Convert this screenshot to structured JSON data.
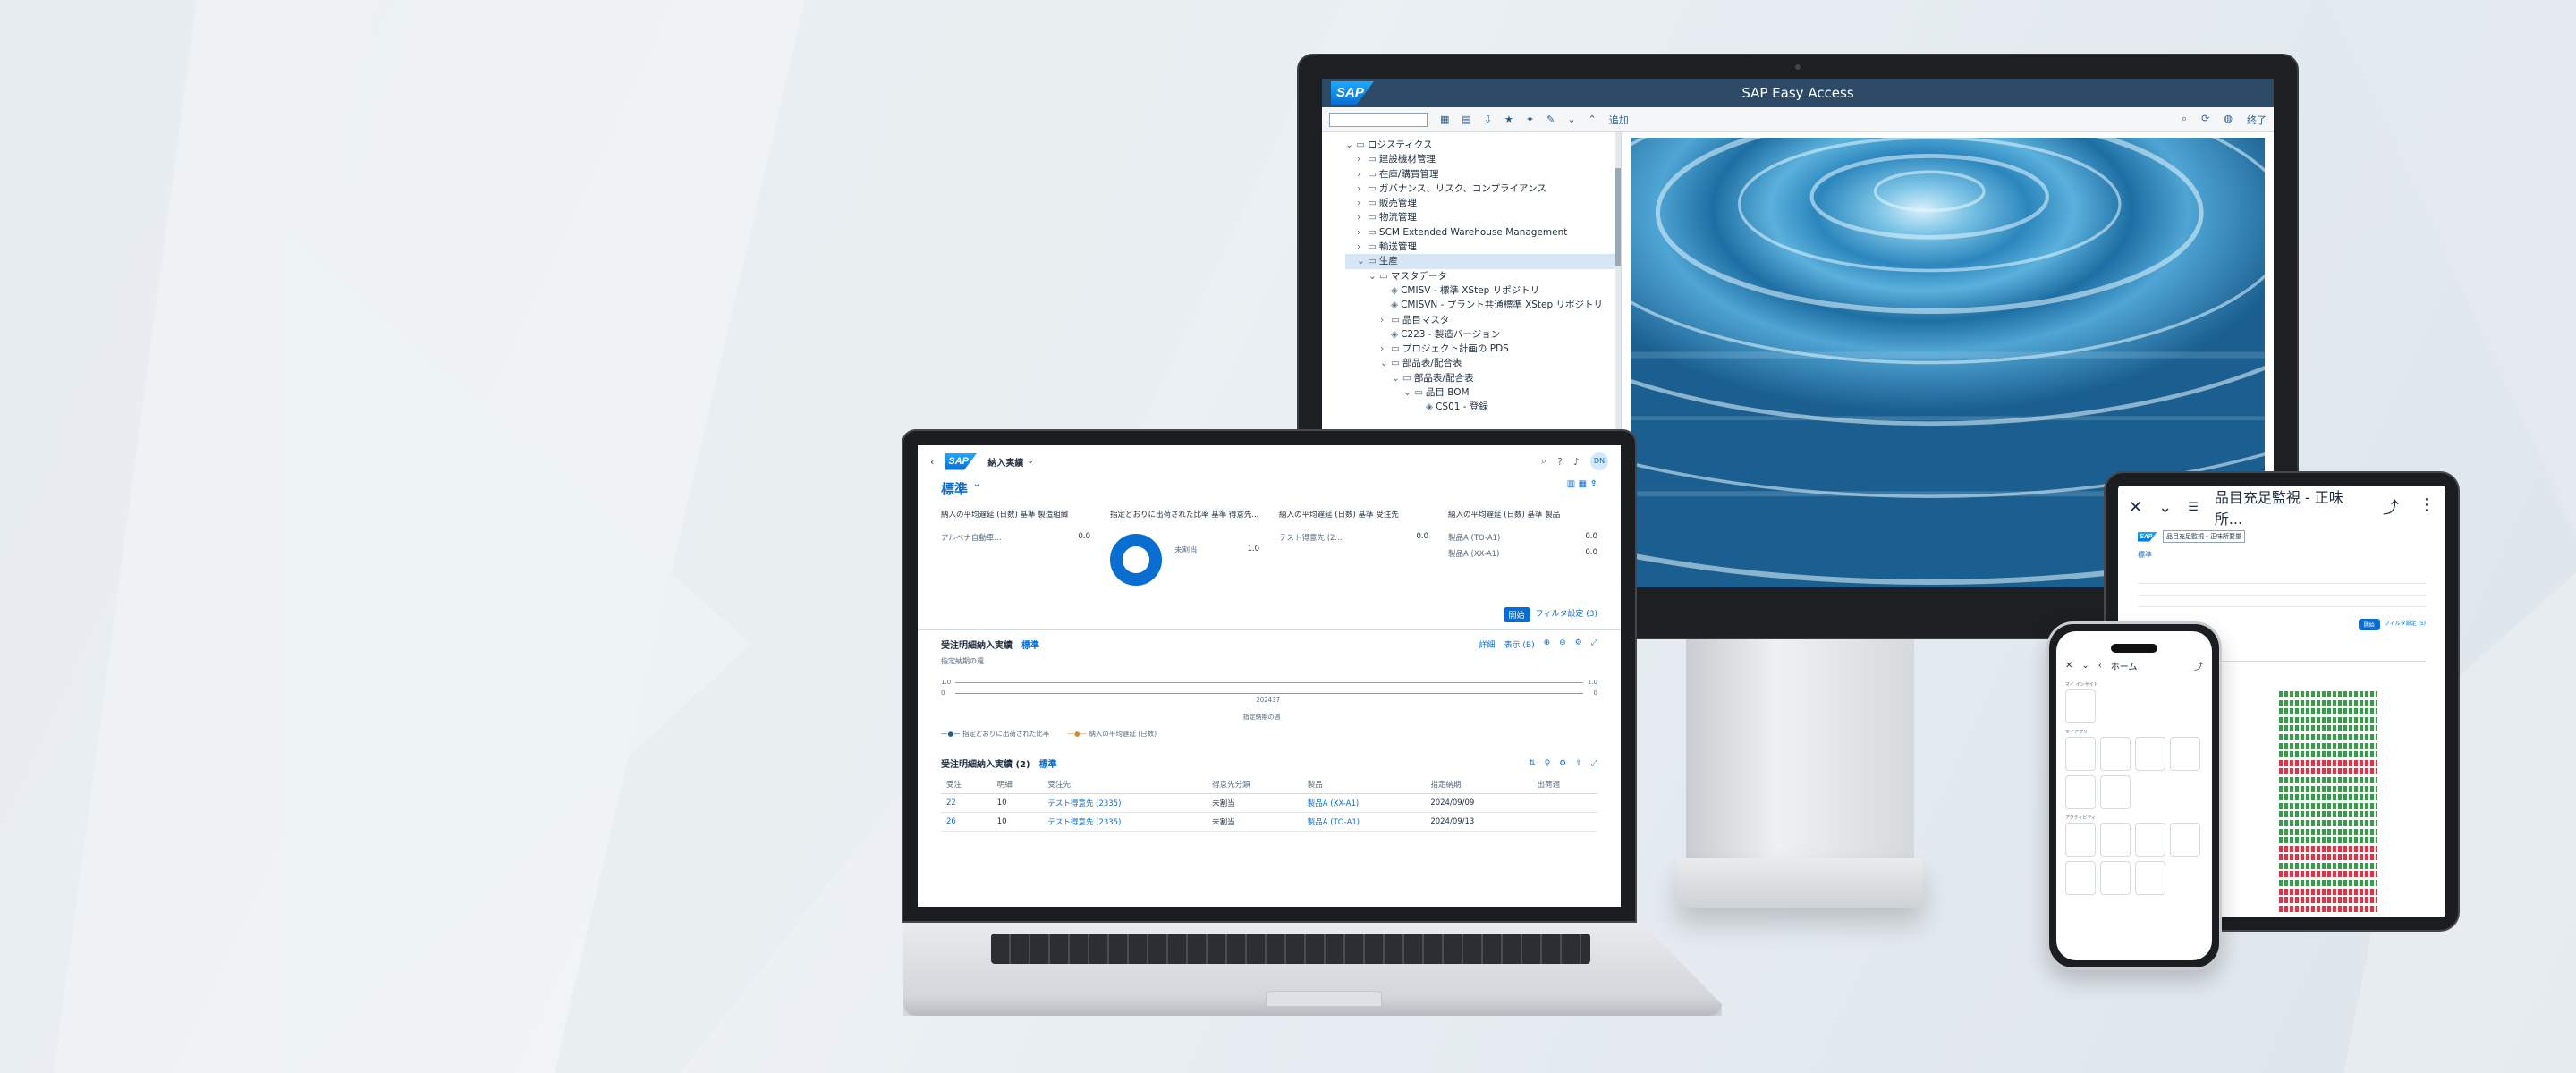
{
  "desktop": {
    "window_title": "SAP Easy Access",
    "logo": "SAP",
    "toolbar_menu": "追加",
    "toolbar_exit": "終了",
    "tree": [
      {
        "label": "ロジスティクス",
        "level": 0,
        "open": true
      },
      {
        "label": "建設機材管理",
        "level": 1
      },
      {
        "label": "在庫/購買管理",
        "level": 1
      },
      {
        "label": "ガバナンス、リスク、コンプライアンス",
        "level": 1
      },
      {
        "label": "販売管理",
        "level": 1
      },
      {
        "label": "物流管理",
        "level": 1
      },
      {
        "label": "SCM Extended Warehouse Management",
        "level": 1
      },
      {
        "label": "輸送管理",
        "level": 1
      },
      {
        "label": "生産",
        "level": 1,
        "open": true,
        "selected": true
      },
      {
        "label": "マスタデータ",
        "level": 2,
        "open": true
      },
      {
        "label": "CMISV - 標準 XStep リポジトリ",
        "level": 3,
        "tx": true
      },
      {
        "label": "CMISVN - プラント共通標準 XStep リポジトリ",
        "level": 3,
        "tx": true
      },
      {
        "label": "品目マスタ",
        "level": 3
      },
      {
        "label": "C223 - 製造バージョン",
        "level": 3,
        "tx": true
      },
      {
        "label": "プロジェクト計画の PDS",
        "level": 3
      },
      {
        "label": "部品表/配合表",
        "level": 3,
        "open": true
      },
      {
        "label": "部品表/配合表",
        "level": 4,
        "open": true
      },
      {
        "label": "品目 BOM",
        "level": 5,
        "open": true
      },
      {
        "label": "CS01 - 登録",
        "level": 6,
        "tx": true
      }
    ]
  },
  "laptop": {
    "logo": "SAP",
    "app_title": "納入実績",
    "avatar": "DN",
    "variant": "標準",
    "kpis": [
      {
        "title": "納入の平均遅延 (日数) 基準 製造組織",
        "rows": [
          {
            "label": "アルベナ自動車...",
            "value": "0.0"
          }
        ]
      },
      {
        "title": "指定どおりに出荷された比率 基準 得意先...",
        "rows": [
          {
            "label": "未割当",
            "value": "1.0"
          }
        ]
      },
      {
        "title": "納入の平均遅延 (日数) 基準 受注先",
        "rows": [
          {
            "label": "テスト得意先 (2...",
            "value": "0.0"
          }
        ]
      },
      {
        "title": "納入の平均遅延 (日数) 基準 製品",
        "rows": [
          {
            "label": "製品A (TO-A1)",
            "value": "0.0"
          },
          {
            "label": "製品A (XX-A1)",
            "value": "0.0"
          }
        ]
      }
    ],
    "go_button": "開始",
    "filter_link": "フィルタ設定 (3)",
    "chart_section": {
      "title": "受注明細納入実績",
      "variant": "標準",
      "toolbar_label_1": "詳細",
      "toolbar_label_2": "表示 (B)",
      "subtitle": "指定納期の週",
      "xlabel": "指定納期の週",
      "x_tick": "202437",
      "y_ticks_left": [
        "1.0",
        "0"
      ],
      "y_ticks_right": [
        "1.0",
        "0"
      ],
      "legend": [
        "指定どおりに出荷された比率",
        "納入の平均遅延 (日数)"
      ]
    },
    "table_section": {
      "title": "受注明細納入実績 (2)",
      "variant": "標準",
      "columns": [
        "受注",
        "明細",
        "受注先",
        "得意先分類",
        "製品",
        "指定納期",
        "出荷週"
      ],
      "rows": [
        [
          "22",
          "10",
          "テスト得意先 (2335)",
          "未割当",
          "製品A (XX-A1)",
          "2024/09/09",
          ""
        ],
        [
          "26",
          "10",
          "テスト得意先 (2335)",
          "未割当",
          "製品A (TO-A1)",
          "2024/09/13",
          ""
        ]
      ]
    }
  },
  "tablet": {
    "title": "品目充足監視 - 正味所...",
    "logo": "SAP",
    "subtitle": "品目充足監視 - 正味所要量",
    "variant": "標準",
    "go_button": "開始",
    "filter_link": "フィルタ設定 (5)"
  },
  "phone": {
    "title": "ホーム",
    "section_1": "マイ インサイト",
    "section_2": "マイアプリ",
    "section_3": "アクティビティ"
  },
  "colors": {
    "sap_blue": "#0a6ed1",
    "header_dark": "#2d4a66",
    "ok_green": "#3a9a4b",
    "error_red": "#d9364c"
  }
}
